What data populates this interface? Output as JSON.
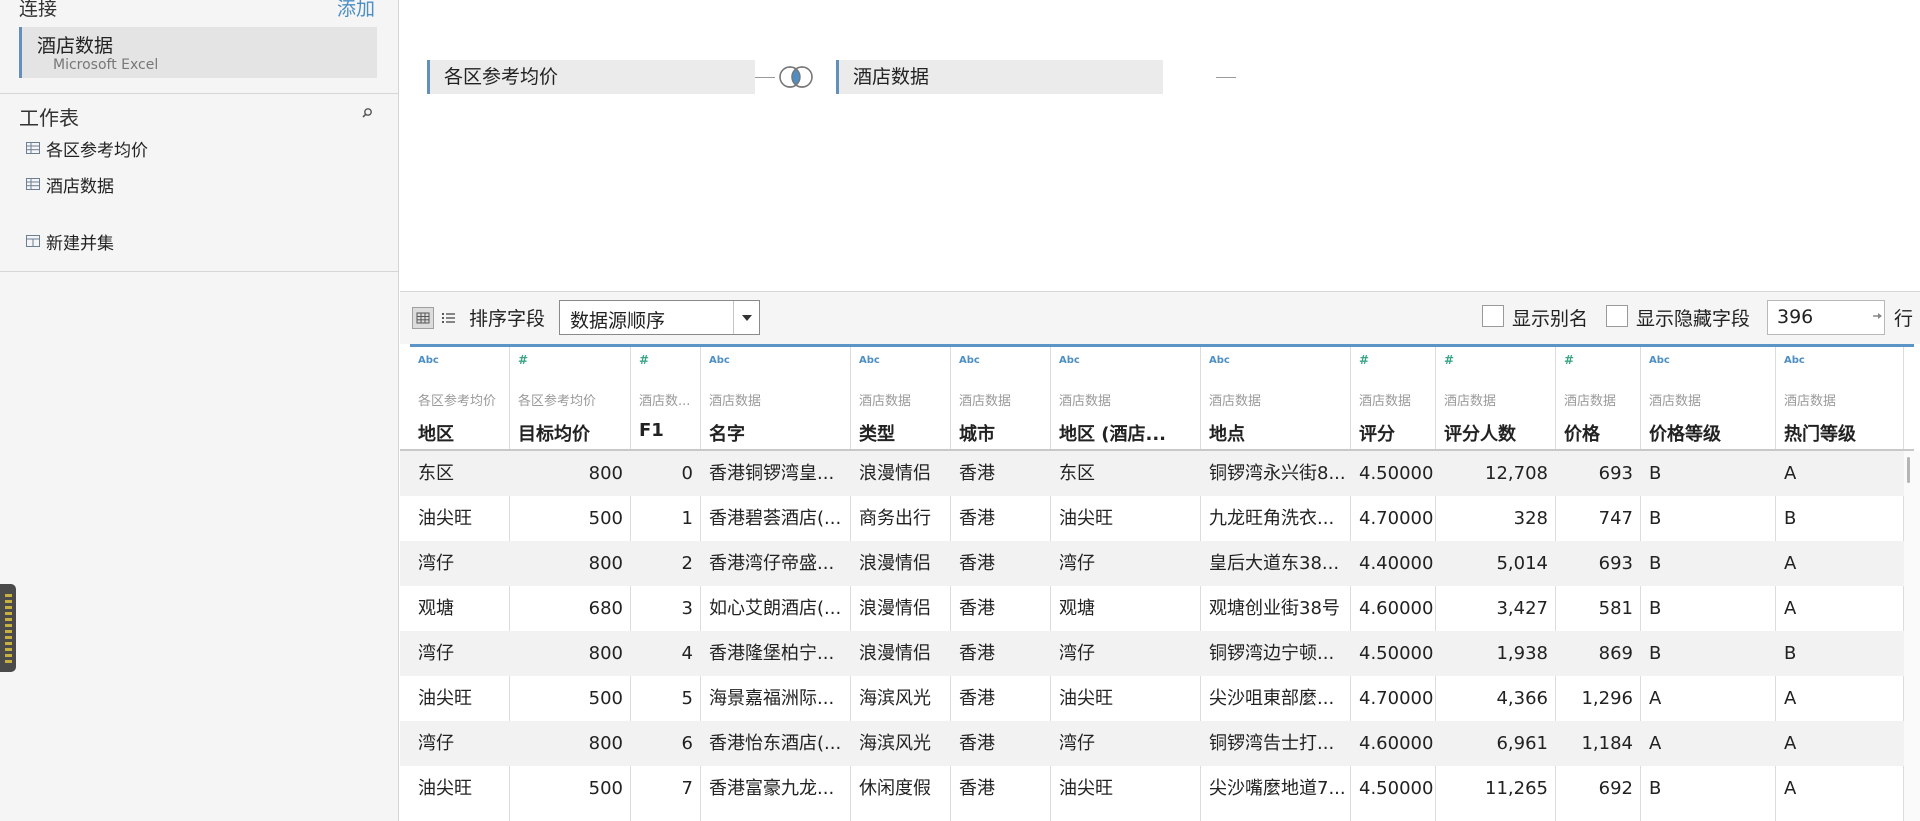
{
  "sidebar": {
    "connections_header": "连接",
    "add_label": "添加",
    "connection": {
      "name": "酒店数据",
      "type": "Microsoft Excel"
    },
    "worksheets_header": "工作表",
    "worksheets": [
      {
        "label": "各区参考均价"
      },
      {
        "label": "酒店数据"
      }
    ],
    "new_union_label": "新建并集"
  },
  "canvas": {
    "left_table": "各区参考均价",
    "right_table": "酒店数据",
    "join_icon": "left-join-icon"
  },
  "toolbar": {
    "sort_label": "排序字段",
    "sort_value": "数据源顺序",
    "show_alias_label": "显示别名",
    "show_hidden_label": "显示隐藏字段",
    "rows_value": "396",
    "rows_suffix": "行",
    "show_alias_checked": false,
    "show_hidden_checked": false
  },
  "grid": {
    "columns": [
      {
        "type": "Abc",
        "source": "各区参考均价",
        "name": "地区"
      },
      {
        "type": "#",
        "source": "各区参考均价",
        "name": "目标均价"
      },
      {
        "type": "#",
        "source": "酒店数...",
        "name": "F1"
      },
      {
        "type": "Abc",
        "source": "酒店数据",
        "name": "名字"
      },
      {
        "type": "Abc",
        "source": "酒店数据",
        "name": "类型"
      },
      {
        "type": "Abc",
        "source": "酒店数据",
        "name": "城市"
      },
      {
        "type": "Abc",
        "source": "酒店数据",
        "name": "地区 (酒店..."
      },
      {
        "type": "Abc",
        "source": "酒店数据",
        "name": "地点"
      },
      {
        "type": "#",
        "source": "酒店数据",
        "name": "评分"
      },
      {
        "type": "#",
        "source": "酒店数据",
        "name": "评分人数"
      },
      {
        "type": "#",
        "source": "酒店数据",
        "name": "价格"
      },
      {
        "type": "Abc",
        "source": "酒店数据",
        "name": "价格等级"
      },
      {
        "type": "Abc",
        "source": "酒店数据",
        "name": "热门等级"
      }
    ],
    "rows": [
      [
        "东区",
        "800",
        "0",
        "香港铜锣湾皇...",
        "浪漫情侣",
        "香港",
        "东区",
        "铜锣湾永兴街8...",
        "4.50000",
        "12,708",
        "693",
        "B",
        "A"
      ],
      [
        "油尖旺",
        "500",
        "1",
        "香港碧荟酒店(...",
        "商务出行",
        "香港",
        "油尖旺",
        "九龙旺角洗衣...",
        "4.70000",
        "328",
        "747",
        "B",
        "B"
      ],
      [
        "湾仔",
        "800",
        "2",
        "香港湾仔帝盛...",
        "浪漫情侣",
        "香港",
        "湾仔",
        "皇后大道东38...",
        "4.40000",
        "5,014",
        "693",
        "B",
        "A"
      ],
      [
        "观塘",
        "680",
        "3",
        "如心艾朗酒店(...",
        "浪漫情侣",
        "香港",
        "观塘",
        "观塘创业街38号",
        "4.60000",
        "3,427",
        "581",
        "B",
        "A"
      ],
      [
        "湾仔",
        "800",
        "4",
        "香港隆堡柏宁...",
        "浪漫情侣",
        "香港",
        "湾仔",
        "铜锣湾边宁顿...",
        "4.50000",
        "1,938",
        "869",
        "B",
        "B"
      ],
      [
        "油尖旺",
        "500",
        "5",
        "海景嘉福洲际...",
        "海滨风光",
        "香港",
        "油尖旺",
        "尖沙咀東部麼...",
        "4.70000",
        "4,366",
        "1,296",
        "A",
        "A"
      ],
      [
        "湾仔",
        "800",
        "6",
        "香港怡东酒店(...",
        "海滨风光",
        "香港",
        "湾仔",
        "铜锣湾告士打...",
        "4.60000",
        "6,961",
        "1,184",
        "A",
        "A"
      ],
      [
        "油尖旺",
        "500",
        "7",
        "香港富豪九龙...",
        "休闲度假",
        "香港",
        "油尖旺",
        "尖沙嘴麼地道7...",
        "4.50000",
        "11,265",
        "692",
        "B",
        "A"
      ]
    ]
  }
}
